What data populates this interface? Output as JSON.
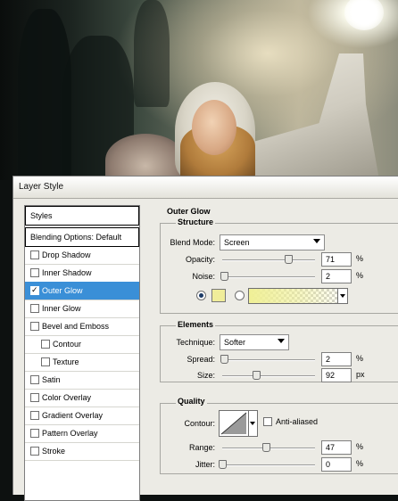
{
  "dialog": {
    "title": "Layer Style"
  },
  "styles_panel": {
    "header": "Styles",
    "items": [
      {
        "label": "Blending Options: Default",
        "checkbox": false,
        "checked": false,
        "selected": false
      },
      {
        "label": "Drop Shadow",
        "checkbox": true,
        "checked": false,
        "selected": false
      },
      {
        "label": "Inner Shadow",
        "checkbox": true,
        "checked": false,
        "selected": false
      },
      {
        "label": "Outer Glow",
        "checkbox": true,
        "checked": true,
        "selected": true
      },
      {
        "label": "Inner Glow",
        "checkbox": true,
        "checked": false,
        "selected": false
      },
      {
        "label": "Bevel and Emboss",
        "checkbox": true,
        "checked": false,
        "selected": false
      },
      {
        "label": "Contour",
        "checkbox": true,
        "checked": false,
        "selected": false,
        "sub": true
      },
      {
        "label": "Texture",
        "checkbox": true,
        "checked": false,
        "selected": false,
        "sub": true
      },
      {
        "label": "Satin",
        "checkbox": true,
        "checked": false,
        "selected": false
      },
      {
        "label": "Color Overlay",
        "checkbox": true,
        "checked": false,
        "selected": false
      },
      {
        "label": "Gradient Overlay",
        "checkbox": true,
        "checked": false,
        "selected": false
      },
      {
        "label": "Pattern Overlay",
        "checkbox": true,
        "checked": false,
        "selected": false
      },
      {
        "label": "Stroke",
        "checkbox": true,
        "checked": false,
        "selected": false
      }
    ]
  },
  "outer_glow": {
    "title": "Outer Glow",
    "structure": {
      "title": "Structure",
      "blend_mode_label": "Blend Mode:",
      "blend_mode": "Screen",
      "opacity_label": "Opacity:",
      "opacity": "71",
      "opacity_value": 0.71,
      "opacity_unit": "%",
      "noise_label": "Noise:",
      "noise": "2",
      "noise_value": 0.02,
      "noise_unit": "%",
      "color_mode": "solid",
      "glow_color": "#f0ed9a"
    },
    "elements": {
      "title": "Elements",
      "technique_label": "Technique:",
      "technique": "Softer",
      "spread_label": "Spread:",
      "spread": "2",
      "spread_value": 0.02,
      "spread_unit": "%",
      "size_label": "Size:",
      "size": "92",
      "size_value": 0.37,
      "size_unit": "px"
    },
    "quality": {
      "title": "Quality",
      "contour_label": "Contour:",
      "anti_aliased_label": "Anti-aliased",
      "anti_aliased": false,
      "range_label": "Range:",
      "range": "47",
      "range_value": 0.47,
      "range_unit": "%",
      "jitter_label": "Jitter:",
      "jitter": "0",
      "jitter_value": 0.0,
      "jitter_unit": "%"
    }
  },
  "colors": {
    "selection": "#3a8fd7",
    "dialog_bg": "#ecebe5"
  }
}
